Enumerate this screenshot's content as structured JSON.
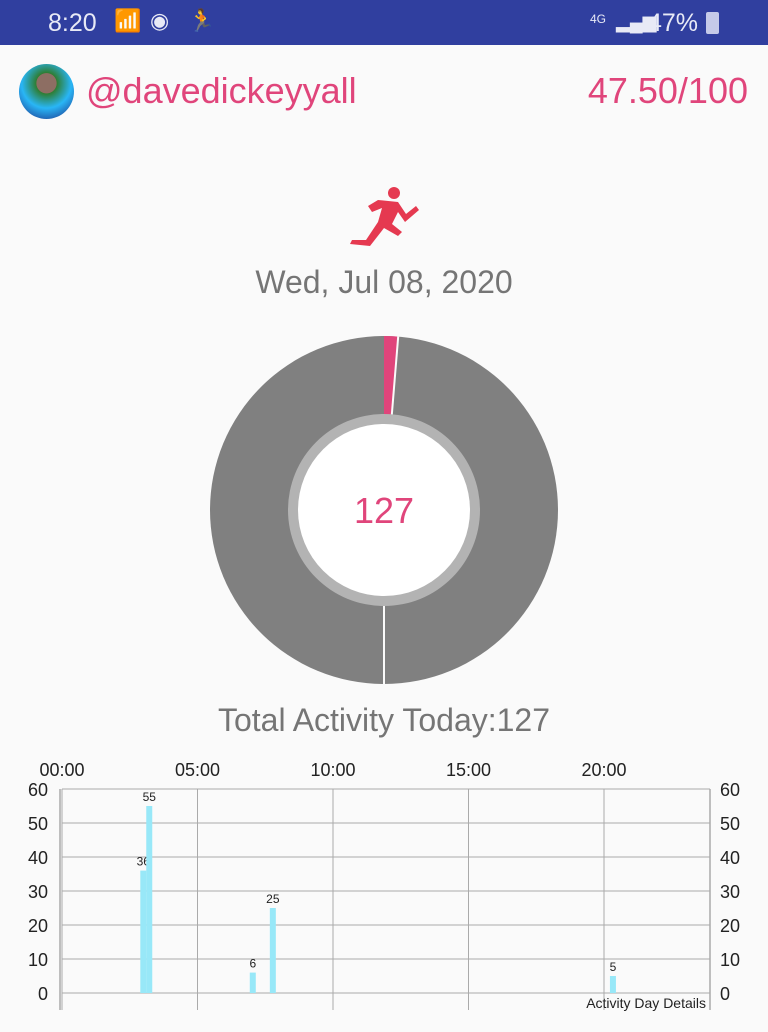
{
  "status_bar": {
    "time": "8:20",
    "battery": "47%",
    "icons": [
      "wifi-icon",
      "vpn-icon",
      "runner-notification-icon",
      "lte-icon",
      "signal-icon",
      "battery-icon"
    ]
  },
  "header": {
    "username": "@davedickeyyall",
    "score": "47.50/100"
  },
  "main": {
    "icon": "runner-icon",
    "date": "Wed, Jul 08, 2020",
    "donut_value": "127",
    "donut_progress_fraction": 0.013,
    "total_label": "Total Activity Today:127"
  },
  "colors": {
    "accent": "#e0457b",
    "donut_bg": "#808080",
    "bar": "#98e8f8",
    "status_bar": "#303f9f"
  },
  "chart_data": {
    "type": "bar",
    "description_label": "Activity Day Details",
    "x_ticks": [
      "00:00",
      "05:00",
      "10:00",
      "15:00",
      "20:00"
    ],
    "x_range_hours": [
      0,
      24
    ],
    "y_ticks": [
      "0",
      "10",
      "20",
      "30",
      "40",
      "50",
      "60"
    ],
    "ylim": [
      0,
      60
    ],
    "grid": true,
    "points": [
      {
        "x": "03:00",
        "hour": 3.0,
        "value": 36,
        "label": "36"
      },
      {
        "x": "03:15",
        "hour": 3.22,
        "value": 55,
        "label": "55"
      },
      {
        "x": "07:00",
        "hour": 7.04,
        "value": 6,
        "label": "6"
      },
      {
        "x": "07:45",
        "hour": 7.78,
        "value": 25,
        "label": "25"
      },
      {
        "x": "20:20",
        "hour": 20.33,
        "value": 5,
        "label": "5"
      }
    ]
  }
}
